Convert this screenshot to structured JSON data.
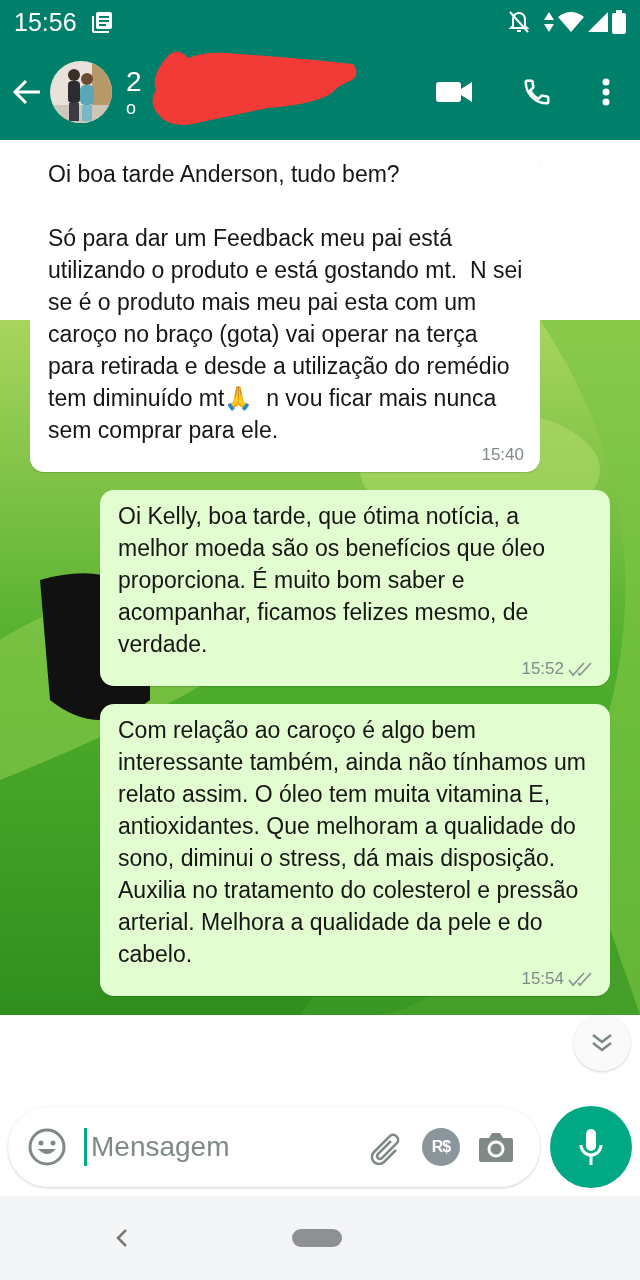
{
  "status_bar": {
    "time": "15:56"
  },
  "header": {
    "name": "2",
    "subtitle": "o"
  },
  "messages": [
    {
      "kind": "incoming",
      "text": "Oi boa tarde Anderson, tudo bem?\n\nSó para dar um Feedback meu pai está utilizando o produto e está gostando mt.  N sei se é o produto mais meu pai esta com um caroço no braço (gota) vai operar na terça para retirada e desde a utilização do remédio tem diminuído mt🙏  n vou ficar mais nunca sem comprar para ele.",
      "time": "15:40"
    },
    {
      "kind": "outgoing",
      "text": "Oi Kelly, boa tarde, que ótima notícia, a melhor moeda são os benefícios que óleo proporciona. É muito bom saber e acompanhar, ficamos felizes mesmo, de verdade.",
      "time": "15:52",
      "read": false
    },
    {
      "kind": "outgoing",
      "text": "Com relação ao caroço é algo bem interessante também, ainda não tínhamos um relato assim. O óleo tem muita vitamina E, antioxidantes. Que melhoram a qualidade do sono, diminui o stress, dá mais disposição. Auxilia no tratamento do colesterol e pressão arterial. Melhora a qualidade da pele e do cabelo.",
      "time": "15:54",
      "read": false
    }
  ],
  "composer": {
    "placeholder": "Mensagem",
    "payment_label": "R$"
  }
}
